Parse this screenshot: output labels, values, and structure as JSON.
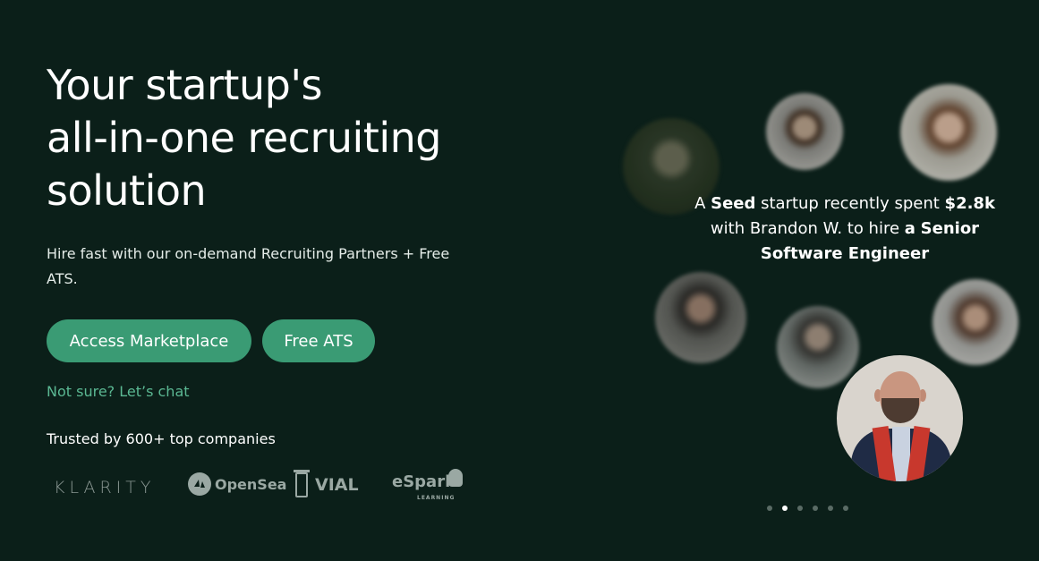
{
  "hero": {
    "title_lines": [
      "Your startup's",
      "all-in-one recruiting",
      "solution"
    ],
    "subtitle": "Hire fast with our on-demand Recruiting Partners + Free ATS.",
    "buttons": {
      "access_marketplace": "Access Marketplace",
      "free_ats": "Free ATS"
    },
    "chat_link": "Not sure? Let’s chat",
    "trusted_text": "Trusted by 600+ top companies"
  },
  "logos": {
    "klarity": "KLARITY",
    "opensea": "OpenSea",
    "vial": "VIAL",
    "espark": "eSpark",
    "espark_sub": "LEARNING"
  },
  "testimonial": {
    "prefix": "A ",
    "stage": "Seed",
    "middle": " startup recently spent ",
    "amount": "$2.8k",
    "middle2": " with Brandon W. to hire ",
    "article": "a",
    "role": "Senior Software Engineer"
  },
  "carousel": {
    "total_dots": 6,
    "active_index": 1
  },
  "colors": {
    "background": "#0b1f19",
    "accent": "#3a9b74",
    "link": "#5bb893"
  }
}
